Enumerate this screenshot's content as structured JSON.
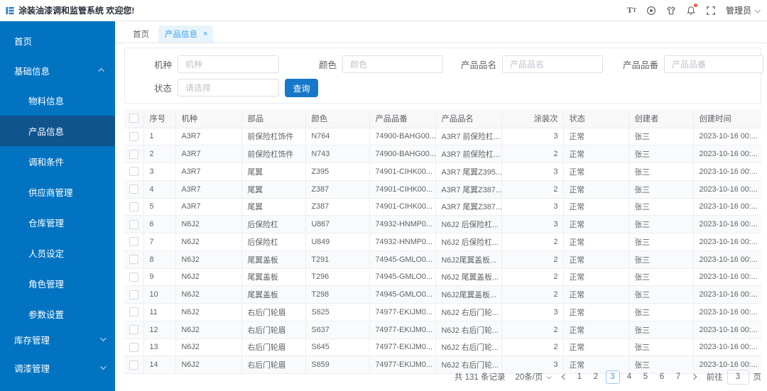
{
  "header": {
    "title": "涂装油漆调和监管系统 欢迎您!",
    "user_label": "管理员"
  },
  "sidebar": {
    "items": [
      {
        "label": "首页",
        "level": "top"
      },
      {
        "label": "基础信息",
        "level": "top",
        "chevron": "up"
      },
      {
        "label": "物料信息",
        "level": "sub"
      },
      {
        "label": "产品信息",
        "level": "sub",
        "active": true
      },
      {
        "label": "调和条件",
        "level": "sub"
      },
      {
        "label": "供应商管理",
        "level": "sub"
      },
      {
        "label": "仓库管理",
        "level": "sub"
      },
      {
        "label": "人员设定",
        "level": "sub"
      },
      {
        "label": "角色管理",
        "level": "sub"
      },
      {
        "label": "参数设置",
        "level": "sub"
      },
      {
        "label": "库存管理",
        "level": "top",
        "chevron": "down"
      },
      {
        "label": "调漆管理",
        "level": "top",
        "chevron": "down"
      }
    ]
  },
  "tabs": [
    {
      "label": "首页",
      "active": false,
      "closable": false
    },
    {
      "label": "产品信息",
      "active": true,
      "closable": true
    }
  ],
  "filters": {
    "fields": [
      {
        "label": "机种",
        "placeholder": "机种",
        "type": "text"
      },
      {
        "label": "颜色",
        "placeholder": "颜色",
        "type": "text"
      },
      {
        "label": "产品品名",
        "placeholder": "产品品名",
        "type": "text"
      },
      {
        "label": "产品品番",
        "placeholder": "产品品番",
        "type": "text"
      },
      {
        "label": "状态",
        "placeholder": "请选择",
        "type": "select"
      }
    ],
    "search_label": "查询"
  },
  "table": {
    "columns": [
      "序号",
      "机种",
      "部品",
      "颜色",
      "产品品番",
      "产品品名",
      "涂装次",
      "状态",
      "创建者",
      "创建时间"
    ],
    "rows": [
      [
        "1",
        "A3R7",
        "前保险杠饰件",
        "N764",
        "74900-BAHG00...",
        "A3R7 前保险杠...",
        "3",
        "正常",
        "张三",
        "2023-10-16 00:..."
      ],
      [
        "2",
        "A3R7",
        "前保险杠饰件",
        "N743",
        "74900-BAHG00...",
        "A3R7 前保险杠...",
        "2",
        "正常",
        "张三",
        "2023-10-16 00:..."
      ],
      [
        "3",
        "A3R7",
        "尾翼",
        "Z395",
        "74901-CIHK00...",
        "A3R7 尾翼Z395...",
        "3",
        "正常",
        "张三",
        "2023-10-16 00:..."
      ],
      [
        "4",
        "A3R7",
        "尾翼",
        "Z387",
        "74901-CIHK00...",
        "A3R7 尾翼Z387...",
        "2",
        "正常",
        "张三",
        "2023-10-16 00:..."
      ],
      [
        "5",
        "A3R7",
        "尾翼",
        "Z387",
        "74901-CIHK00...",
        "A3R7 尾翼Z387...",
        "3",
        "正常",
        "张三",
        "2023-10-16 00:..."
      ],
      [
        "6",
        "N6J2",
        "后保险杠",
        "U867",
        "74932-HNMP0...",
        "N6J2 后保险杠...",
        "3",
        "正常",
        "张三",
        "2023-10-16 00:..."
      ],
      [
        "7",
        "N6J2",
        "后保险杠",
        "U849",
        "74932-HNMP0...",
        "N6J2 后保险杠...",
        "2",
        "正常",
        "张三",
        "2023-10-16 00:..."
      ],
      [
        "8",
        "N6J2",
        "尾翼盖板",
        "T291",
        "74945-GMLO0...",
        "N6J2尾翼盖板...",
        "2",
        "正常",
        "张三",
        "2023-10-16 00:..."
      ],
      [
        "9",
        "N6J2",
        "尾翼盖板",
        "T296",
        "74945-GMLO0...",
        "N6J2 尾翼盖板...",
        "2",
        "正常",
        "张三",
        "2023-10-16 00:..."
      ],
      [
        "10",
        "N6J2",
        "尾翼盖板",
        "T298",
        "74945-GMLO0...",
        "N6J2尾翼盖板...",
        "2",
        "正常",
        "张三",
        "2023-10-16 00:..."
      ],
      [
        "11",
        "N6J2",
        "右后门轮眉",
        "S625",
        "74977-EKIJM0...",
        "N6J2 右后门轮...",
        "3",
        "正常",
        "张三",
        "2023-10-16 00:..."
      ],
      [
        "12",
        "N6J2",
        "右后门轮眉",
        "S637",
        "74977-EKIJM0...",
        "N6J2 右后门轮...",
        "2",
        "正常",
        "张三",
        "2023-10-16 00:..."
      ],
      [
        "13",
        "N6J2",
        "右后门轮眉",
        "S645",
        "74977-EKIJM0...",
        "N6J2 右后门轮...",
        "2",
        "正常",
        "张三",
        "2023-10-16 00:..."
      ],
      [
        "14",
        "N6J2",
        "右后门轮眉",
        "S659",
        "74977-EKIJM0...",
        "N6J2 右后门轮...",
        "3",
        "正常",
        "张三",
        "2023-10-16 00:..."
      ]
    ]
  },
  "pagination": {
    "total_label": "共 131 条记录",
    "page_size_label": "20条/页",
    "pages": [
      "1",
      "2",
      "3",
      "4",
      "5",
      "6",
      "7"
    ],
    "active_page": "3",
    "goto_label": "前往",
    "goto_value": "3",
    "page_suffix": "页"
  },
  "colors": {
    "sidebar": "#0173c1",
    "sidebar_active": "#10548d",
    "primary_button": "#1778ca",
    "tab_active_bg": "#e7f3fd",
    "tab_active_text": "#3d9fe8",
    "notification_dot": "#f25643"
  }
}
